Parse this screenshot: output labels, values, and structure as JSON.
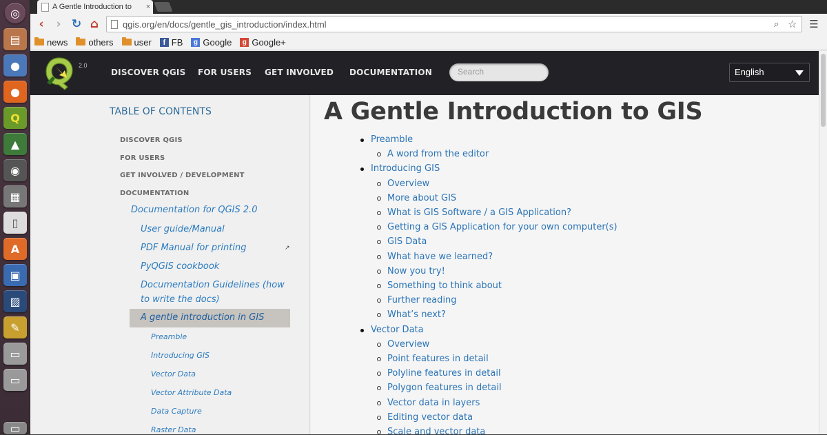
{
  "browser": {
    "tab_title": "A Gentle Introduction to",
    "tab_close": "×",
    "url": "qgis.org/en/docs/gentle_gis_introduction/index.html",
    "bookmarks": [
      {
        "label": "news",
        "icon": "folder-icon"
      },
      {
        "label": "others",
        "icon": "folder-icon"
      },
      {
        "label": "user",
        "icon": "folder-icon"
      },
      {
        "label": "FB",
        "icon": "facebook-icon"
      },
      {
        "label": "Google",
        "icon": "google-icon"
      },
      {
        "label": "Google+",
        "icon": "google-plus-icon"
      }
    ]
  },
  "header": {
    "version": "2.0",
    "nav": [
      "DISCOVER QGIS",
      "FOR USERS",
      "GET INVOLVED",
      "DOCUMENTATION"
    ],
    "search_placeholder": "Search",
    "language": "English"
  },
  "sidebar": {
    "title": "TABLE OF CONTENTS",
    "sections": [
      "DISCOVER QGIS",
      "FOR USERS",
      "GET INVOLVED / DEVELOPMENT",
      "DOCUMENTATION"
    ],
    "doc_title": "Documentation for QGIS 2.0",
    "doc_items": [
      "User guide/Manual",
      "PDF Manual for printing",
      "PyQGIS cookbook",
      "Documentation Guidelines (how",
      "to write the docs)"
    ],
    "active_item": "A gentle introduction in GIS",
    "sub_items": [
      "Preamble",
      "Introducing GIS",
      "Vector Data",
      "Vector Attribute Data",
      "Data Capture",
      "Raster Data"
    ]
  },
  "content": {
    "title": "A Gentle Introduction to GIS",
    "items": [
      {
        "level": 1,
        "label": "Preamble"
      },
      {
        "level": 2,
        "label": "A word from the editor"
      },
      {
        "level": 1,
        "label": "Introducing GIS"
      },
      {
        "level": 2,
        "label": "Overview"
      },
      {
        "level": 2,
        "label": "More about GIS"
      },
      {
        "level": 2,
        "label": "What is GIS Software / a GIS Application?"
      },
      {
        "level": 2,
        "label": "Getting a GIS Application for your own computer(s)"
      },
      {
        "level": 2,
        "label": "GIS Data"
      },
      {
        "level": 2,
        "label": "What have we learned?"
      },
      {
        "level": 2,
        "label": "Now you try!"
      },
      {
        "level": 2,
        "label": "Something to think about"
      },
      {
        "level": 2,
        "label": "Further reading"
      },
      {
        "level": 2,
        "label": "What’s next?"
      },
      {
        "level": 1,
        "label": "Vector Data"
      },
      {
        "level": 2,
        "label": "Overview"
      },
      {
        "level": 2,
        "label": "Point features in detail"
      },
      {
        "level": 2,
        "label": "Polyline features in detail"
      },
      {
        "level": 2,
        "label": "Polygon features in detail"
      },
      {
        "level": 2,
        "label": "Vector data in layers"
      },
      {
        "level": 2,
        "label": "Editing vector data"
      },
      {
        "level": 2,
        "label": "Scale and vector data"
      }
    ]
  }
}
